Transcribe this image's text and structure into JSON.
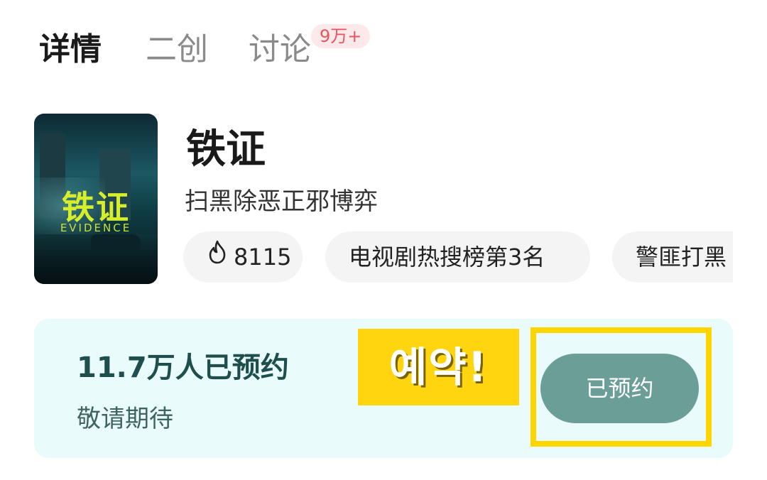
{
  "tabs": [
    {
      "label": "详情",
      "active": true
    },
    {
      "label": "二创",
      "active": false
    },
    {
      "label": "讨论",
      "active": false
    }
  ],
  "discussion_badge": "9万+",
  "show": {
    "title": "铁证",
    "subtitle": "扫黑除恶正邪博弈",
    "poster": {
      "title_art": "铁证",
      "english_art": "EVIDENCE"
    }
  },
  "chips": [
    {
      "icon": "fire-icon",
      "label": "8115"
    },
    {
      "label": "电视剧热搜榜第3名"
    },
    {
      "label": "警匪打黑"
    }
  ],
  "reservation": {
    "count_text": "11.7万人已预约",
    "status_text": "敬请期待",
    "button_label": "已预约"
  },
  "sticker": {
    "text": "예약!"
  },
  "colors": {
    "accent": "#6c9e98",
    "card_bg": "#eafbfb",
    "badge_text": "#e6545e",
    "badge_bg": "#fde9ea",
    "highlight": "#ffd500"
  }
}
